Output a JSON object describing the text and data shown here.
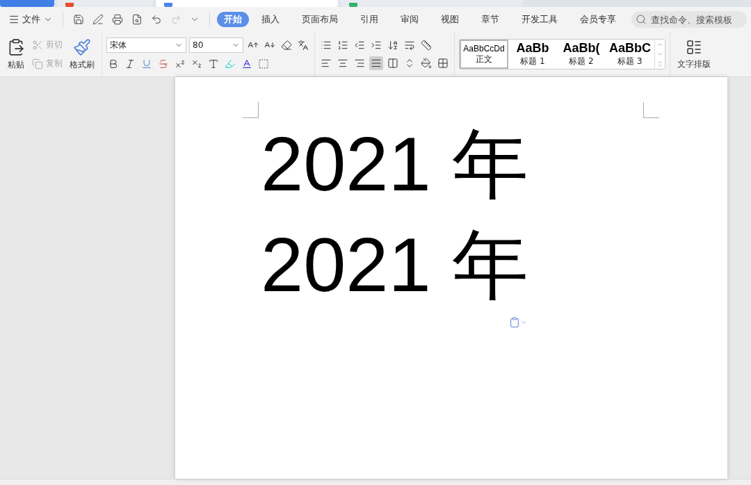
{
  "document_tabs": [
    {
      "kind": "home",
      "selected": false
    },
    {
      "kind": "app",
      "selected": false
    },
    {
      "kind": "writer",
      "selected": true
    },
    {
      "kind": "sheet",
      "selected": false
    }
  ],
  "file_menu": {
    "label": "文件"
  },
  "menu_tabs": [
    {
      "label": "开始",
      "selected": true
    },
    {
      "label": "插入",
      "selected": false
    },
    {
      "label": "页面布局",
      "selected": false
    },
    {
      "label": "引用",
      "selected": false
    },
    {
      "label": "审阅",
      "selected": false
    },
    {
      "label": "视图",
      "selected": false
    },
    {
      "label": "章节",
      "selected": false
    },
    {
      "label": "开发工具",
      "selected": false
    },
    {
      "label": "会员专享",
      "selected": false
    }
  ],
  "search": {
    "placeholder": "查找命令、搜索模板"
  },
  "clipboard": {
    "paste": "粘贴",
    "cut": {
      "label": "剪切",
      "disabled": true
    },
    "copy": {
      "label": "复制",
      "disabled": true
    },
    "format_painter": "格式刷"
  },
  "font": {
    "name": "宋体",
    "size": "80"
  },
  "alignments": [
    {
      "selected": false
    },
    {
      "selected": false
    },
    {
      "selected": false
    },
    {
      "selected": true
    },
    {
      "selected": false
    }
  ],
  "styles": [
    {
      "kind": "body",
      "preview": "AaBbCcDd",
      "name": "正文",
      "selected": true
    },
    {
      "kind": "heading",
      "preview": "AaBb",
      "name": "标题 1",
      "selected": false
    },
    {
      "kind": "heading",
      "preview": "AaBb(",
      "name": "标题 2",
      "selected": false
    },
    {
      "kind": "heading",
      "preview": "AaBbC",
      "name": "标题 3",
      "selected": false
    }
  ],
  "text_layout": {
    "label": "文字排版"
  },
  "document": {
    "lines": [
      "2021 年",
      "2021 年"
    ]
  }
}
